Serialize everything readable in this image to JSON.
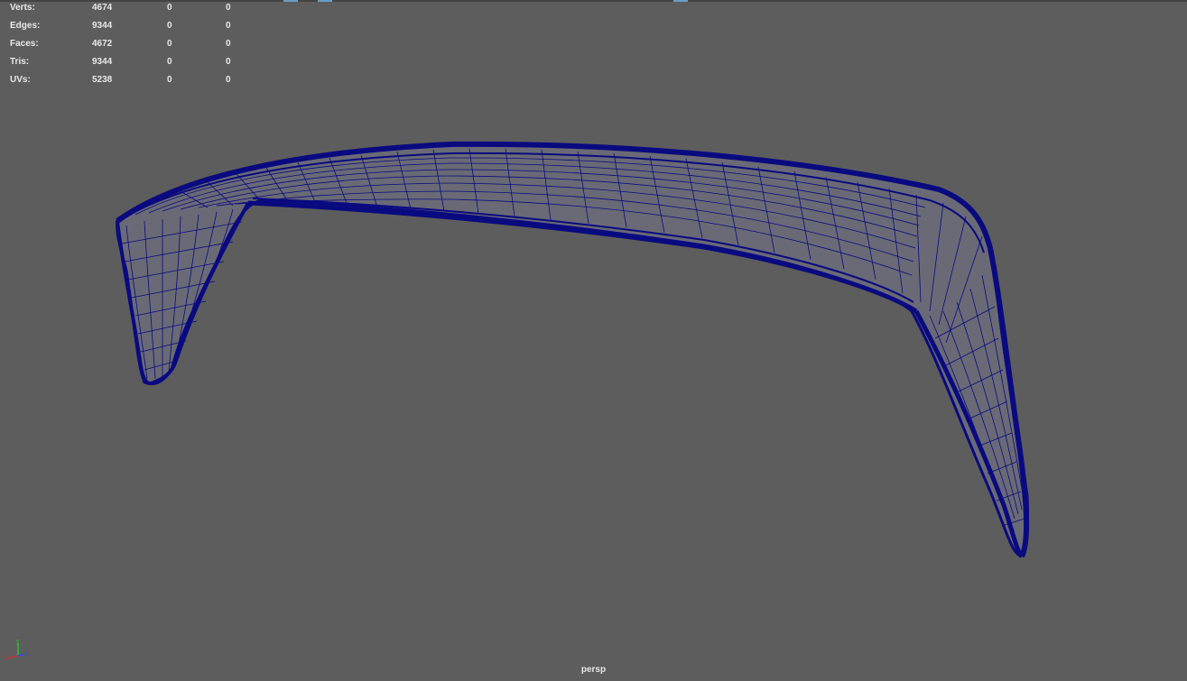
{
  "hud": {
    "rows": [
      {
        "label": "Verts:",
        "v1": "4674",
        "v2": "0",
        "v3": "0"
      },
      {
        "label": "Edges:",
        "v1": "9344",
        "v2": "0",
        "v3": "0"
      },
      {
        "label": "Faces:",
        "v1": "4672",
        "v2": "0",
        "v3": "0"
      },
      {
        "label": "Tris:",
        "v1": "9344",
        "v2": "0",
        "v3": "0"
      },
      {
        "label": "UVs:",
        "v1": "5238",
        "v2": "0",
        "v3": "0"
      }
    ]
  },
  "viewport": {
    "camera": "persp",
    "background_color": "#5d5d5d",
    "wireframe_color": "#0a0a80",
    "surface_color": "#6d6d78"
  },
  "axis_gizmo": {
    "x_label": "x",
    "y_label": "y",
    "z_label": "z",
    "x_color": "#d03030",
    "y_color": "#30c030",
    "z_color": "#3050e0"
  }
}
